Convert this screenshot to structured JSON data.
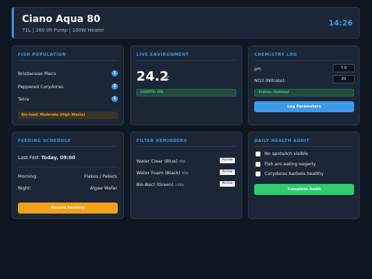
{
  "header": {
    "title": "Ciano Aqua 80",
    "subtitle": "71L | 260 l/h Pump | 100W Heater",
    "clock": "14:26"
  },
  "fish_population": {
    "title": "FISH POPULATION",
    "rows": [
      {
        "name": "Bristlenose Pleco",
        "count": "1"
      },
      {
        "name": "Peppered Corydoras",
        "count": "2"
      },
      {
        "name": "Tetra",
        "count": "1"
      }
    ],
    "bioload": "Bio-load: Moderate (High Waste)"
  },
  "live_environment": {
    "title": "LIVE ENVIRONMENT",
    "temperature": "24.2",
    "unit": "°C",
    "lights": "LIGHTS: ON"
  },
  "chemistry_log": {
    "title": "CHEMISTRY LOG",
    "ph_label": "pH:",
    "ph_value": "7.0",
    "no3_label": "NO3 (Nitrate):",
    "no3_value": "20",
    "status": "Status: Optimal",
    "button": "Log Parameters"
  },
  "feeding_schedule": {
    "title": "FEEDING SCHEDULE",
    "last_fed_label": "Last Fed:",
    "last_fed_value": "Today, 09:00",
    "morning_label": "Morning:",
    "morning_value": "Flakes / Pellets",
    "night_label": "Night:",
    "night_value": "Algae Wafer",
    "button": "Record Feeding"
  },
  "filter_reminders": {
    "title": "FILTER REMINDERS",
    "items": [
      {
        "name": "Water Clear (Blue)",
        "days": "30d",
        "action": "Renew"
      },
      {
        "name": "Water Foam (Black)",
        "days": "90d",
        "action": "Renew"
      },
      {
        "name": "Bio-Bact (Green)",
        "days": "140d",
        "action": "Renew"
      }
    ]
  },
  "health_audit": {
    "title": "DAILY HEALTH AUDIT",
    "checks": [
      {
        "label": "No spots/Ich visible"
      },
      {
        "label": "Fish are eating eagerly"
      },
      {
        "label": "Corydoras barbels healthy"
      }
    ],
    "button": "Complete Audit"
  },
  "colors": {
    "accent": "#3d9be9",
    "warning": "#f2a11a",
    "success": "#2ecc71",
    "background": "#0f1722",
    "card": "#1b2636"
  }
}
